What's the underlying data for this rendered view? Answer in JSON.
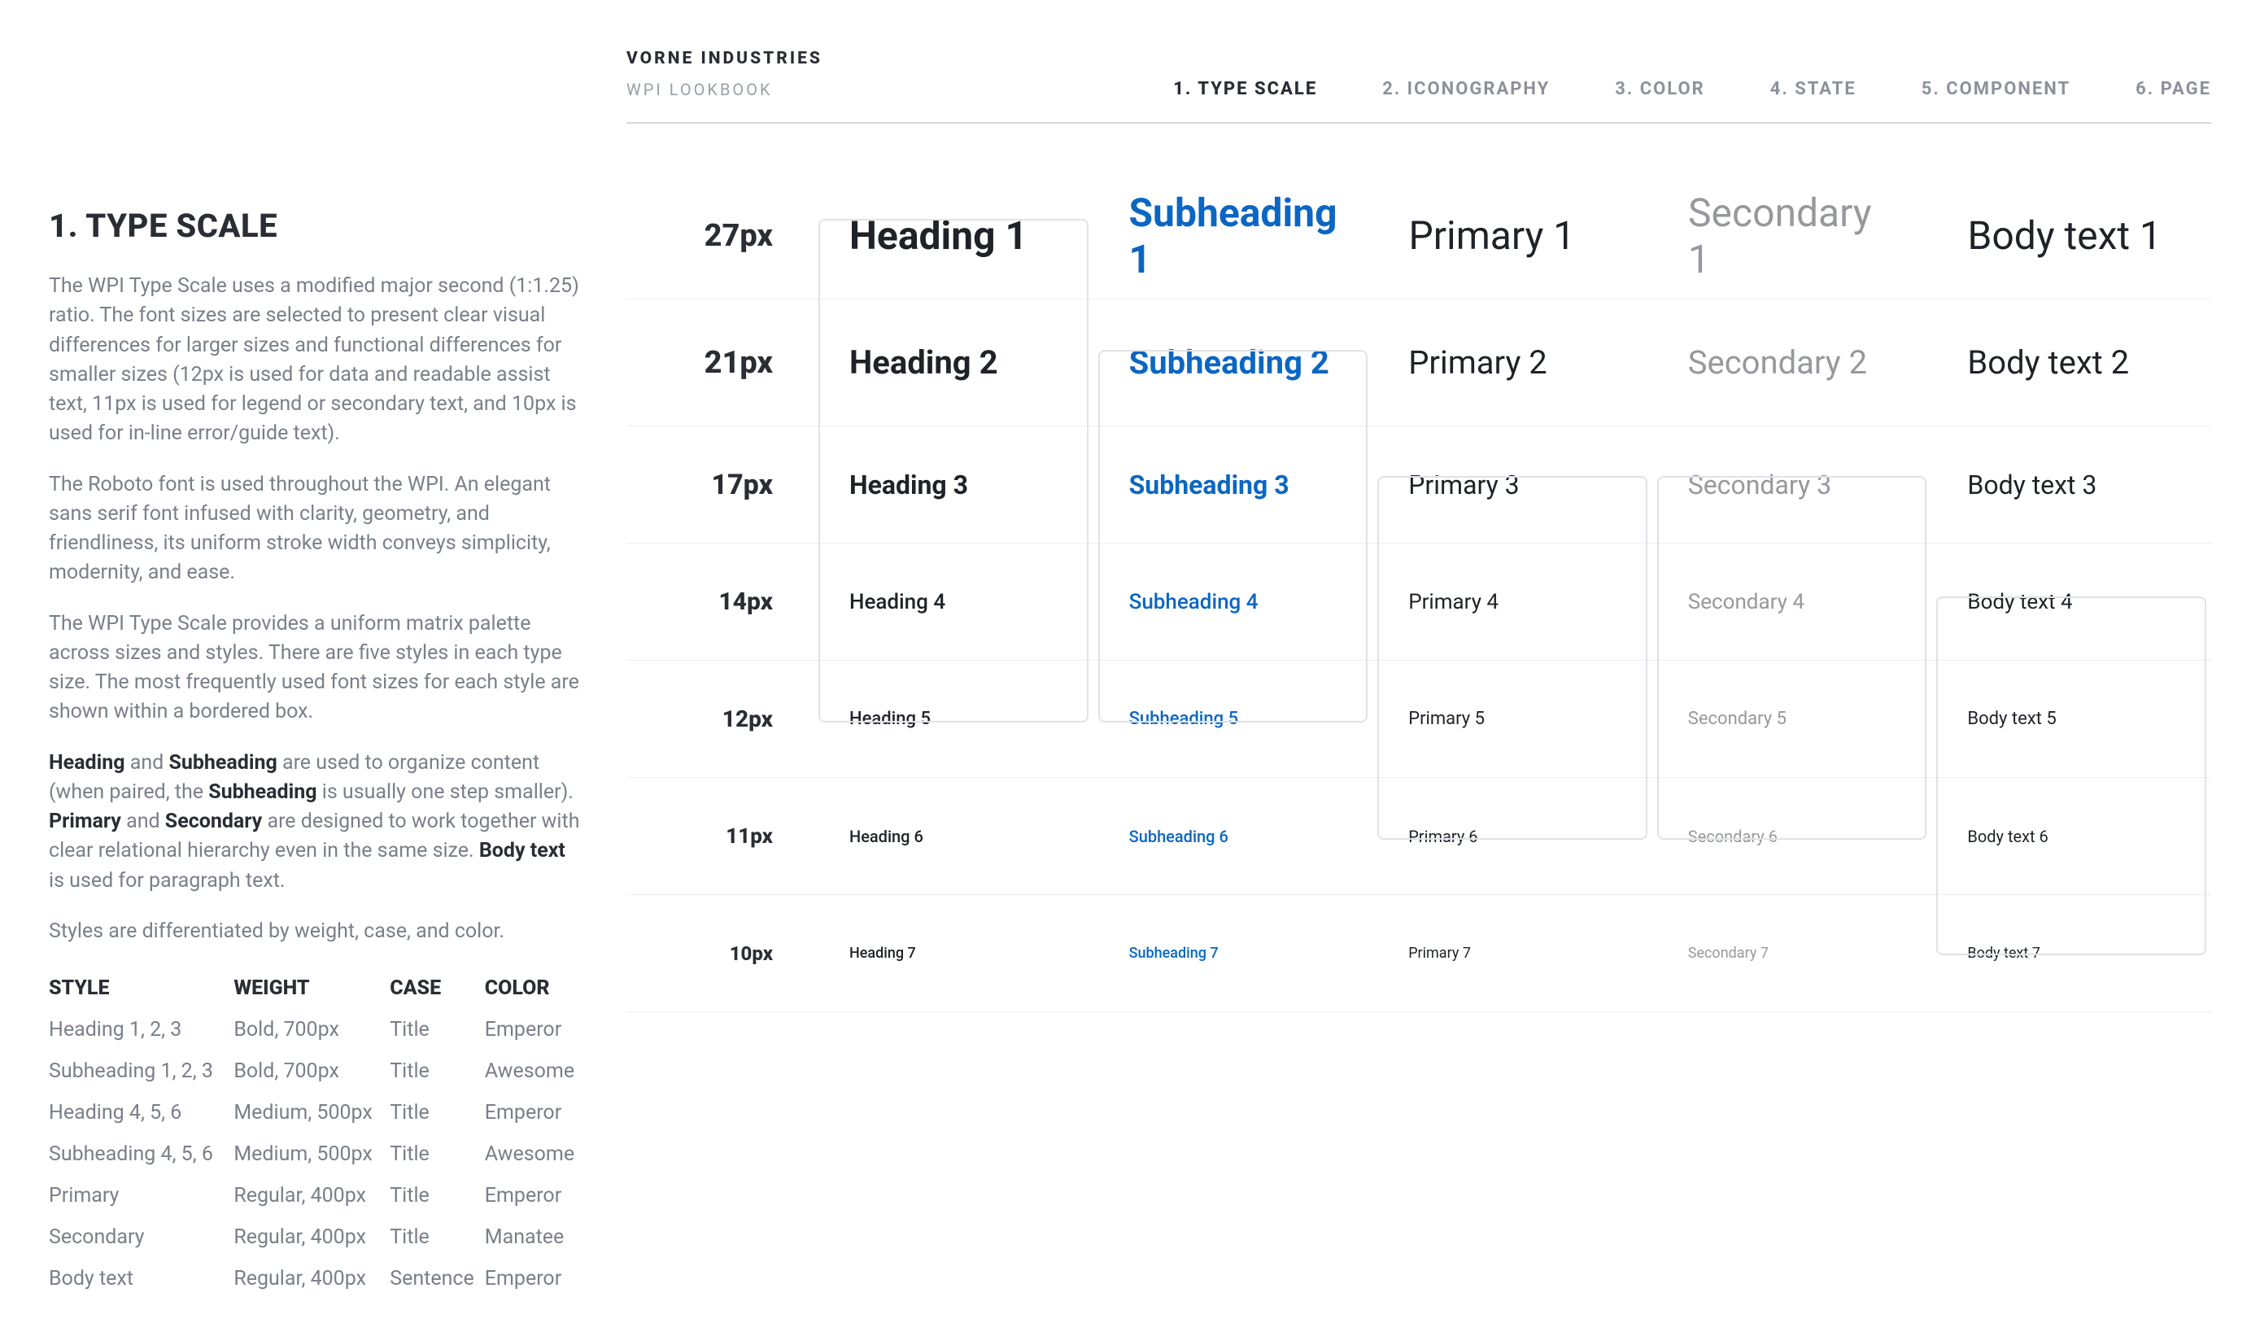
{
  "header": {
    "brand": "VORNE INDUSTRIES",
    "sub": "WPI LOOKBOOK",
    "nav": [
      {
        "label": "1. TYPE SCALE",
        "active": true
      },
      {
        "label": "2. ICONOGRAPHY",
        "active": false
      },
      {
        "label": "3. COLOR",
        "active": false
      },
      {
        "label": "4. STATE",
        "active": false
      },
      {
        "label": "5. COMPONENT",
        "active": false
      },
      {
        "label": "6. PAGE",
        "active": false
      }
    ]
  },
  "sidebar": {
    "title": "1. TYPE SCALE",
    "p1": "The WPI Type Scale uses a modified major second (1:1.25) ratio. The font sizes are selected to present clear visual differences for larger sizes and functional differences for smaller sizes (12px is used for data and readable assist text, 11px is used for legend or secondary text, and 10px is used for in-line error/guide text).",
    "p2": "The Roboto font is used throughout the WPI. An elegant sans serif font infused with clarity, geometry, and friendliness, its uniform stroke width conveys simplicity, modernity, and ease.",
    "p3": "The WPI Type Scale provides a uniform matrix palette across sizes and styles. There are five styles in each type size. The most frequently used font sizes for each style are shown within a bordered box.",
    "p4_parts": {
      "a": "Heading",
      "b": " and ",
      "c": "Subheading",
      "d": " are used to organize content (when paired, the ",
      "e": "Subheading",
      "f": " is usually one step smaller). ",
      "g": "Primary",
      "h": " and ",
      "i": "Secondary",
      "j": " are designed to work together with clear relational hierarchy even in the same size. ",
      "k": "Body text",
      "l": " is used for paragraph text."
    },
    "p5": "Styles are differentiated by weight, case, and color.",
    "tableHead": {
      "style": "STYLE",
      "weight": "WEIGHT",
      "case": "CASE",
      "color": "COLOR"
    },
    "tableRows": [
      {
        "style": "Heading 1, 2, 3",
        "weight": "Bold, 700px",
        "case": "Title",
        "color": "Emperor"
      },
      {
        "style": "Subheading 1, 2, 3",
        "weight": "Bold, 700px",
        "case": "Title",
        "color": "Awesome"
      },
      {
        "style": "Heading 4, 5, 6",
        "weight": "Medium, 500px",
        "case": "Title",
        "color": "Emperor"
      },
      {
        "style": "Subheading 4, 5, 6",
        "weight": "Medium, 500px",
        "case": "Title",
        "color": "Awesome"
      },
      {
        "style": "Primary",
        "weight": "Regular, 400px",
        "case": "Title",
        "color": "Emperor"
      },
      {
        "style": "Secondary",
        "weight": "Regular, 400px",
        "case": "Title",
        "color": "Manatee"
      },
      {
        "style": "Body text",
        "weight": "Regular, 400px",
        "case": "Sentence",
        "color": "Emperor"
      }
    ]
  },
  "grid": {
    "rows": [
      {
        "px": "27px",
        "heading": "Heading 1",
        "subheading": "Subheading 1",
        "primary": "Primary 1",
        "secondary": "Secondary 1",
        "body": "Body text 1"
      },
      {
        "px": "21px",
        "heading": "Heading 2",
        "subheading": "Subheading 2",
        "primary": "Primary 2",
        "secondary": "Secondary 2",
        "body": "Body text 2"
      },
      {
        "px": "17px",
        "heading": "Heading 3",
        "subheading": "Subheading 3",
        "primary": "Primary 3",
        "secondary": "Secondary 3",
        "body": "Body text 3"
      },
      {
        "px": "14px",
        "heading": "Heading 4",
        "subheading": "Subheading 4",
        "primary": "Primary 4",
        "secondary": "Secondary 4",
        "body": "Body text 4"
      },
      {
        "px": "12px",
        "heading": "Heading 5",
        "subheading": "Subheading 5",
        "primary": "Primary 5",
        "secondary": "Secondary 5",
        "body": "Body text 5"
      },
      {
        "px": "11px",
        "heading": "Heading 6",
        "subheading": "Subheading 6",
        "primary": "Primary 6",
        "secondary": "Secondary 6",
        "body": "Body text 6"
      },
      {
        "px": "10px",
        "heading": "Heading 7",
        "subheading": "Subheading 7",
        "primary": "Primary 7",
        "secondary": "Secondary 7",
        "body": "Body text 7"
      }
    ]
  }
}
